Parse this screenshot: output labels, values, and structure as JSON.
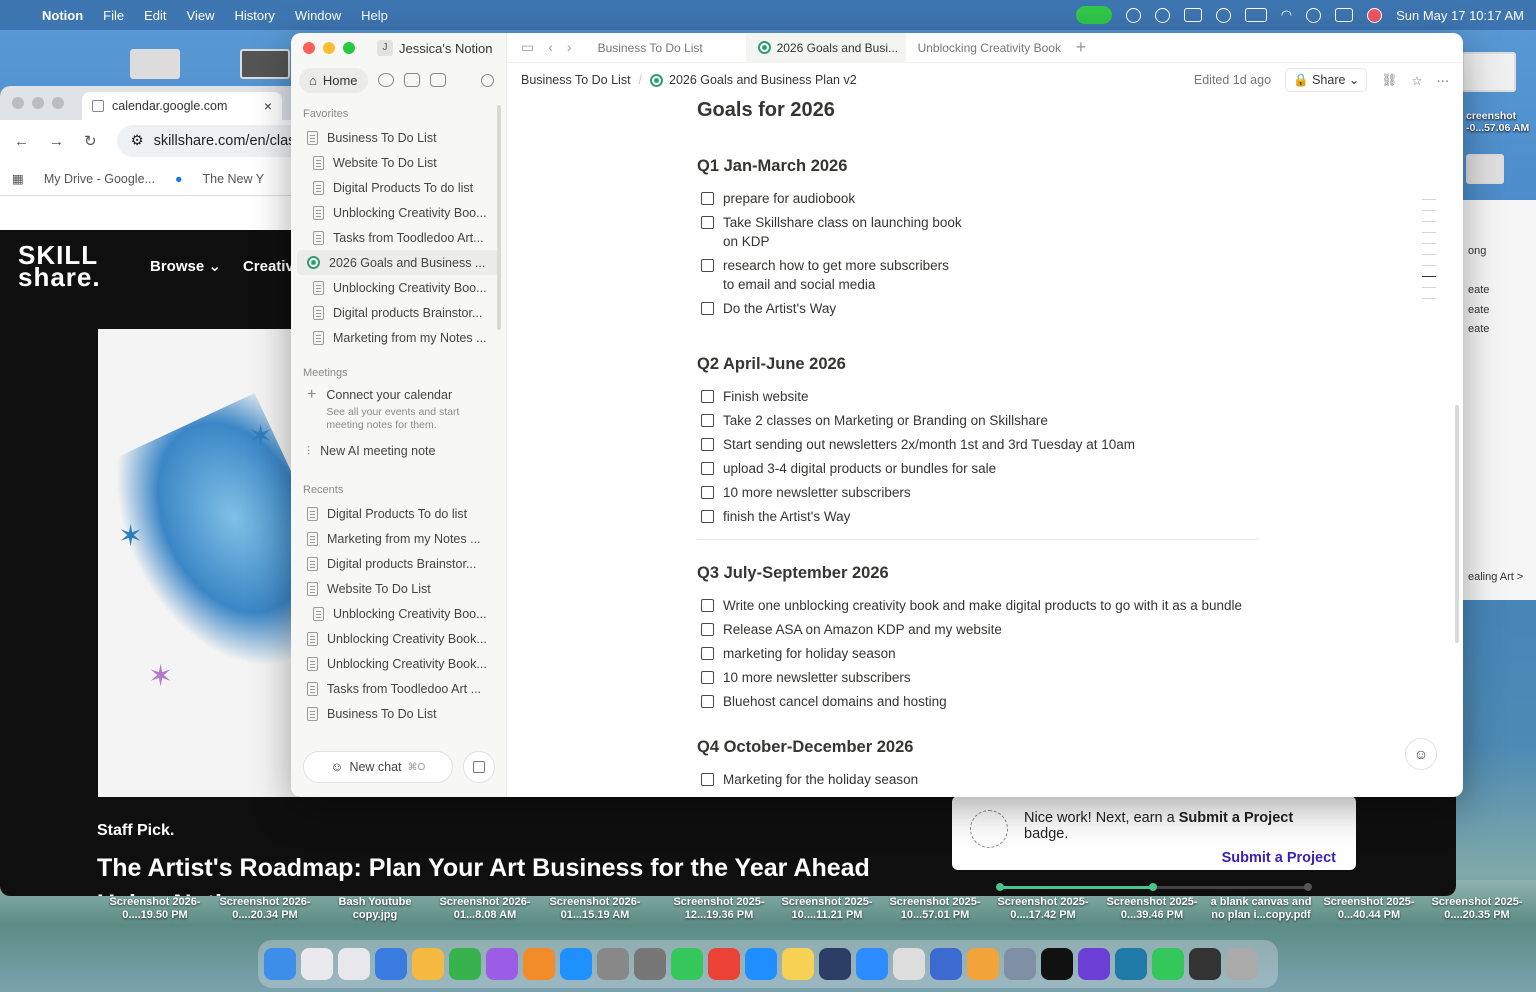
{
  "menubar": {
    "app": "Notion",
    "items": [
      "File",
      "Edit",
      "View",
      "History",
      "Window",
      "Help"
    ],
    "datetime": "Sun May 17  10:17 AM"
  },
  "browser": {
    "tab_title": "calendar.google.com",
    "url": "skillshare.com/en/classes,",
    "bookmarks": [
      "My Drive - Google...",
      "The New Y"
    ],
    "nav": [
      "Browse",
      "Creative"
    ],
    "logo": "SKILL share.",
    "staff_pick": "Staff Pick.",
    "course_title": "The Artist's Roadmap: Plan Your Art Business for the Year Ahead Using Notion",
    "badge_text_prefix": "Nice work! Next, earn a ",
    "badge_text_bold": "Submit a Project",
    "badge_text_suffix": " badge.",
    "badge_link": "Submit a Project",
    "progress": 0.5
  },
  "rightwin": {
    "labels": [
      "creenshot",
      "-0...57.06 AM",
      "ong",
      "eate",
      "eate",
      "eate",
      "ealing Art >"
    ]
  },
  "notion": {
    "workspace": "Jessica's Notion",
    "workspace_initial": "J",
    "home": "Home",
    "favorites_title": "Favorites",
    "favorites": [
      "Business To Do List",
      "Website To Do List",
      "Digital Products To do list",
      "Unblocking Creativity Boo...",
      "Tasks from Toodledoo Art...",
      "2026 Goals and Business ...",
      "Unblocking Creativity Boo...",
      "Digital products Brainstor...",
      "Marketing from my Notes ..."
    ],
    "meetings_title": "Meetings",
    "connect_calendar": "Connect your calendar",
    "connect_calendar_sub": "See all your events and start meeting notes for them.",
    "ai_meeting": "New AI meeting note",
    "recents_title": "Recents",
    "recents": [
      "Digital Products To do list",
      "Marketing from my Notes ...",
      "Digital products Brainstor...",
      "Website To Do List",
      "Unblocking Creativity Boo...",
      "Unblocking Creativity Book...",
      "Unblocking Creativity Book...",
      "Tasks from Toodledoo Art ...",
      "Business To Do List"
    ],
    "new_chat": "New chat",
    "new_chat_kbd": "⌘O",
    "tabs": [
      "Business To Do List",
      "2026 Goals and Busi...",
      "Unblocking Creativity Book"
    ],
    "breadcrumb": [
      "Business To Do List",
      "2026 Goals and Business Plan v2"
    ],
    "edited": "Edited 1d ago",
    "share": "Share",
    "page_heading": "Goals for 2026",
    "sections": [
      {
        "title": "Q1 Jan-March 2026",
        "todos": [
          "prepare for audiobook",
          "Take Skillshare class on launching book on KDP",
          "research how to get more subscribers to email and social media",
          "Do the Artist's Way"
        ]
      },
      {
        "title": "Q2 April-June 2026",
        "todos": [
          "Finish website",
          "Take 2 classes on Marketing or Branding on Skillshare",
          "Start sending out newsletters 2x/month 1st and 3rd Tuesday at 10am",
          "upload 3-4 digital products or bundles for sale",
          "10 more newsletter subscribers",
          "finish the Artist's Way"
        ]
      },
      {
        "title": "Q3 July-September 2026",
        "todos": [
          "Write one unblocking creativity book and make digital products to go with it as a bundle",
          "Release ASA on Amazon KDP and my website",
          "marketing for holiday season",
          "10 more newsletter subscribers",
          "Bluehost cancel domains and hosting"
        ]
      },
      {
        "title": "Q4 October-December 2026",
        "todos": [
          "Marketing for the holiday season"
        ]
      }
    ]
  },
  "desktop_files": [
    "Screenshot 2026-0....19.50 PM",
    "Screenshot 2026-0....20.34 PM",
    "Bash Youtube copy.jpg",
    "Screenshot 2026-01...8.08 AM",
    "Screenshot 2026-01...15.19 AM",
    "Screenshot 2025-12...19.36 PM",
    "Screenshot 2025-10....11.21 PM",
    "Screenshot 2025-10...57.01 PM",
    "Screenshot 2025-0....17.42 PM",
    "Screenshot 2025-0...39.46 PM",
    "a blank canvas and no plan i...copy.pdf",
    "Screenshot 2025-0...40.44 PM",
    "Screenshot 2025-0....20.35 PM"
  ],
  "dock_colors": [
    "#3d8ee8",
    "#e9e9ee",
    "#e8e8ec",
    "#3a7be0",
    "#f5b942",
    "#38b24d",
    "#9b5de5",
    "#f28c28",
    "#1e90ff",
    "#888888",
    "#777777",
    "#34c759",
    "#ea4335",
    "#1f8fff",
    "#f7d154",
    "#2c3e66",
    "#2d8cff",
    "#dddddd",
    "#3b6bd1",
    "#f2a33a",
    "#7f8fa6",
    "#111111",
    "#6b3fd6",
    "#1f7aa8",
    "#34c759",
    "#333333",
    "#aaaaaa"
  ]
}
